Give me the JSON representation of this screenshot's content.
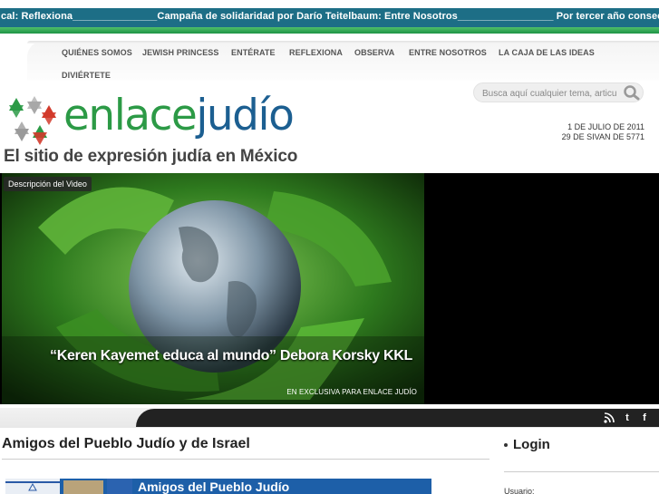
{
  "ticker": {
    "text": "cal: Reflexiona_______________Campaña de solidaridad por Darío Teitelbaum: Entre Nosotros_________________ Por tercer año consecutivo"
  },
  "nav": {
    "items": [
      "QUIÉNES SOMOS",
      "JEWISH PRINCESS",
      "ENTÉRATE",
      "REFLEXIONA",
      "OBSERVA",
      "ENTRE NOSOTROS",
      "LA CAJA DE LAS IDEAS",
      "DIVIÉRTETE"
    ]
  },
  "brand": {
    "word_1": "enlace",
    "word_2": "judío",
    "tagline": "El sitio de expresión judía en México",
    "colors": {
      "green": "#2c9a46",
      "blue": "#1c5f91"
    }
  },
  "search": {
    "placeholder": "Busca aquí cualquier tema, articulo"
  },
  "date": {
    "gregorian": "1 DE JULIO DE 2011",
    "hebrew": "29 DE SIVAN DE 5771"
  },
  "video": {
    "desc_button": "Descripción del Video",
    "title": "“Keren Kayemet educa al mundo” Debora Korsky KKL",
    "subtitle": "EN EXCLUSIVA PARA ENLACE JUDÍO"
  },
  "social": {
    "items": [
      "rss-icon",
      "twitter-icon",
      "facebook-icon"
    ]
  },
  "main": {
    "heading": "Amigos del Pueblo Judío y de Israel",
    "banner_text": "Amigos del Pueblo Judío"
  },
  "sidebar": {
    "login_title": "Login",
    "user_label": "Usuario:"
  }
}
